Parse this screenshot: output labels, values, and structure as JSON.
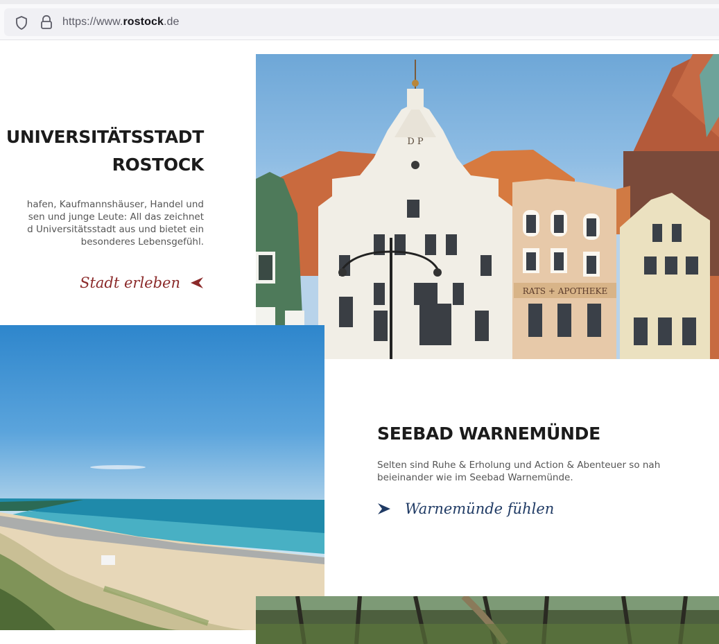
{
  "browser": {
    "url_prefix": "https://www.",
    "url_domain": "rostock",
    "url_suffix": ".de",
    "icons": [
      "shield-icon",
      "lock-icon"
    ]
  },
  "section_city": {
    "heading_line1": "D UNIVERSITÄTSSTADT",
    "heading_line2": "ROSTOCK",
    "body_lines": [
      "hafen, Kaufmannshäuser, Handel und",
      "sen und junge Leute: All das zeichnet",
      "d Universitätsstadt aus und bietet ein",
      "besonderes Lebensgefühl."
    ],
    "cta_label": "Stadt erleben",
    "cta_icon": "arrow-left-icon",
    "photo_sign": "RATS + APOTHEKE",
    "photo_gable_letters": "D P"
  },
  "section_seebad": {
    "heading": "SEEBAD WARNEMÜNDE",
    "body_lines": [
      "Selten sind Ruhe & Erholung und Action & Abenteuer so nah",
      "beieinander wie im Seebad Warnemünde."
    ],
    "cta_label": "Warnemünde fühlen",
    "cta_icon": "arrow-right-icon"
  },
  "colors": {
    "accent_red": "#8b2a2a",
    "accent_blue": "#1f3a64",
    "heading": "#1b1b1b",
    "body": "#555555"
  }
}
